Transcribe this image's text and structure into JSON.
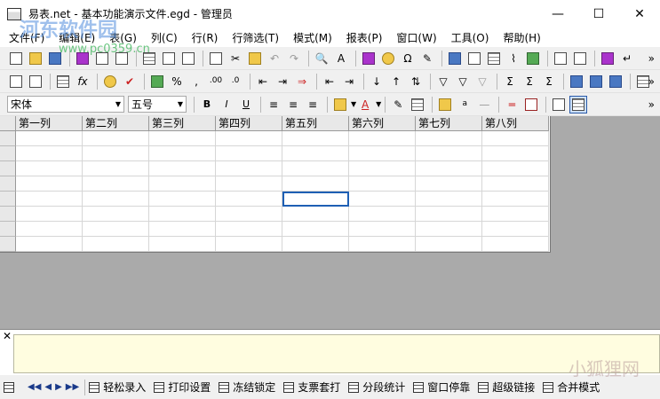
{
  "window": {
    "title": "易表.net  -  基本功能演示文件.egd  -  管理员",
    "minimize": "—",
    "maximize": "☐",
    "close": "✕"
  },
  "menu": [
    "文件(F)",
    "编辑(E)",
    "表(G)",
    "列(C)",
    "行(R)",
    "行筛选(T)",
    "模式(M)",
    "报表(P)",
    "窗口(W)",
    "工具(O)",
    "帮助(H)"
  ],
  "toolbar1": {
    "icons": [
      "new-icon",
      "open-icon",
      "save-icon",
      "book-icon",
      "print-icon",
      "print-preview-icon",
      "sheet-icon",
      "sheet2-icon",
      "sheet3-icon",
      "copy-icon",
      "cut-icon",
      "paste-icon",
      "undo-icon",
      "redo-icon",
      "find-icon",
      "replace-icon",
      "calculator-icon",
      "chart-icon",
      "omega-icon",
      "brush-icon",
      "monitor-icon",
      "book2-icon",
      "table-icon",
      "attach-icon",
      "export-icon",
      "layout-icon",
      "layout2-icon",
      "purple-icon",
      "return-icon"
    ],
    "more": "»"
  },
  "toolbar2": {
    "icons": [
      "insert-row-icon",
      "edit-row-icon",
      "record-icon",
      "function-icon",
      "clock-icon",
      "check-icon",
      "currency-icon",
      "percent-icon",
      "comma-icon",
      "decimal-inc-icon",
      "decimal-dec-icon",
      "col-left-icon",
      "col-right-icon",
      "col-move-icon",
      "sort-asc-icon",
      "sort-desc-icon",
      "filter-icon",
      "filter-all-icon",
      "filter-clear-icon",
      "sum-icon",
      "sum-col-icon",
      "sum-row-icon",
      "panel-left-icon",
      "panel-mid-icon",
      "panel-right-icon",
      "table-settings-icon"
    ],
    "more": "»"
  },
  "format_bar": {
    "font": "宋体",
    "size": "五号",
    "bold": "B",
    "italic": "I",
    "underline": "U",
    "more": "»"
  },
  "sheet": {
    "columns": [
      "第一列",
      "第二列",
      "第三列",
      "第四列",
      "第五列",
      "第六列",
      "第七列",
      "第八列"
    ],
    "row_count": 8
  },
  "notes": {
    "close": "✕",
    "text": ""
  },
  "statusbar": {
    "nav": [
      "◀◀",
      "◀",
      "▶",
      "▶▶"
    ],
    "items": [
      "轻松录入",
      "打印设置",
      "冻结锁定",
      "支票套打",
      "分段统计",
      "窗口停靠",
      "超级链接",
      "合并模式"
    ]
  },
  "watermarks": {
    "site_cn": "河东软件园",
    "site_url": "www.pc0359.cn",
    "fox": "小狐狸网"
  },
  "colors": {
    "workspace_bg": "#aaaaaa",
    "note_bg": "#fffde0",
    "selection": "#1e5fb4"
  }
}
